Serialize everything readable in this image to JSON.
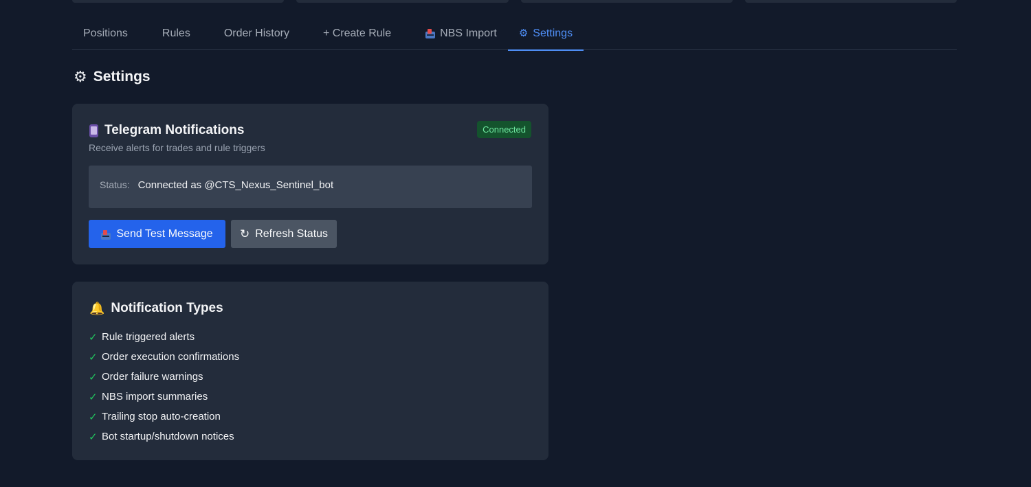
{
  "tabs": [
    {
      "label": "Positions"
    },
    {
      "label": "Rules"
    },
    {
      "label": "Order History"
    },
    {
      "label": "+ Create Rule"
    },
    {
      "label": "NBS Import"
    },
    {
      "label": "Settings",
      "active": true
    }
  ],
  "page": {
    "title": "Settings"
  },
  "telegram": {
    "title": "Telegram Notifications",
    "subtitle": "Receive alerts for trades and rule triggers",
    "badge": "Connected",
    "status_label": "Status:",
    "status_value": "Connected as @CTS_Nexus_Sentinel_bot",
    "send_test_label": "Send Test Message",
    "refresh_label": "Refresh Status"
  },
  "notification_types": {
    "title": "Notification Types",
    "items": [
      "Rule triggered alerts",
      "Order execution confirmations",
      "Order failure warnings",
      "NBS import summaries",
      "Trailing stop auto-creation",
      "Bot startup/shutdown notices"
    ]
  },
  "colors": {
    "background": "#121a2a",
    "card": "#232c3b",
    "accent": "#4f8ff7",
    "primary_button": "#2463eb",
    "success": "#22c55e"
  },
  "icons": {
    "settings_tab": "gear-icon",
    "nbs_tab": "mailbox-icon",
    "telegram": "phone-icon",
    "notifications": "bell-icon",
    "refresh": "refresh-icon",
    "check": "check-icon"
  }
}
